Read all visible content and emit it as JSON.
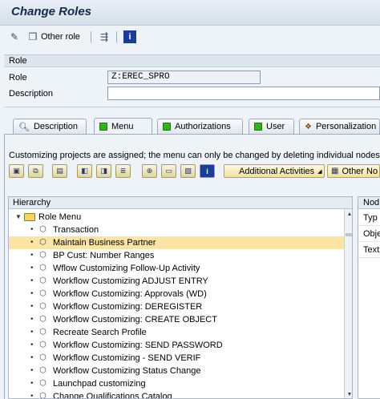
{
  "window": {
    "title": "Change Roles"
  },
  "app_toolbar": {
    "other_role_label": "Other role"
  },
  "role_section": {
    "header": "Role",
    "role_label": "Role",
    "role_value": "Z:EREC_SPRO",
    "description_label": "Description",
    "description_value": ""
  },
  "tabs": [
    {
      "label": "Description"
    },
    {
      "label": "Menu"
    },
    {
      "label": "Authorizations"
    },
    {
      "label": "User"
    },
    {
      "label": "Personalization"
    }
  ],
  "menu_tab": {
    "info_text": "Customizing projects are assigned; the menu can only be changed by deleting individual nodes.",
    "additional_activities_label": "Additional Activities",
    "other_node_label": "Other No"
  },
  "tree": {
    "header": "Hierarchy",
    "root_label": "Role Menu",
    "items": [
      {
        "label": "Transaction"
      },
      {
        "label": "Maintain Business Partner"
      },
      {
        "label": "BP Cust: Number Ranges"
      },
      {
        "label": "Wflow Customizing Follow-Up Activity"
      },
      {
        "label": "Workflow Customizing  ADJUST ENTRY"
      },
      {
        "label": "Workflow Customizing: Approvals (WD)"
      },
      {
        "label": "Workflow Customizing: DEREGISTER"
      },
      {
        "label": "Workflow Customizing: CREATE OBJECT"
      },
      {
        "label": "Recreate Search Profile"
      },
      {
        "label": "Workflow Customizing: SEND PASSWORD"
      },
      {
        "label": "Workflow Customizing - SEND VERIF"
      },
      {
        "label": "Workflow Customizing Status Change"
      },
      {
        "label": "Launchpad customizing"
      },
      {
        "label": "Change Qualifications Catalog"
      }
    ],
    "selected_index": 1
  },
  "node_panel": {
    "header": "Nod",
    "rows": [
      {
        "label": "Typ"
      },
      {
        "label": "Obje"
      },
      {
        "label": "Text"
      }
    ]
  },
  "colors": {
    "selection": "#fbe4a6",
    "title": "#17284a",
    "tab_status": "#2fb619"
  }
}
